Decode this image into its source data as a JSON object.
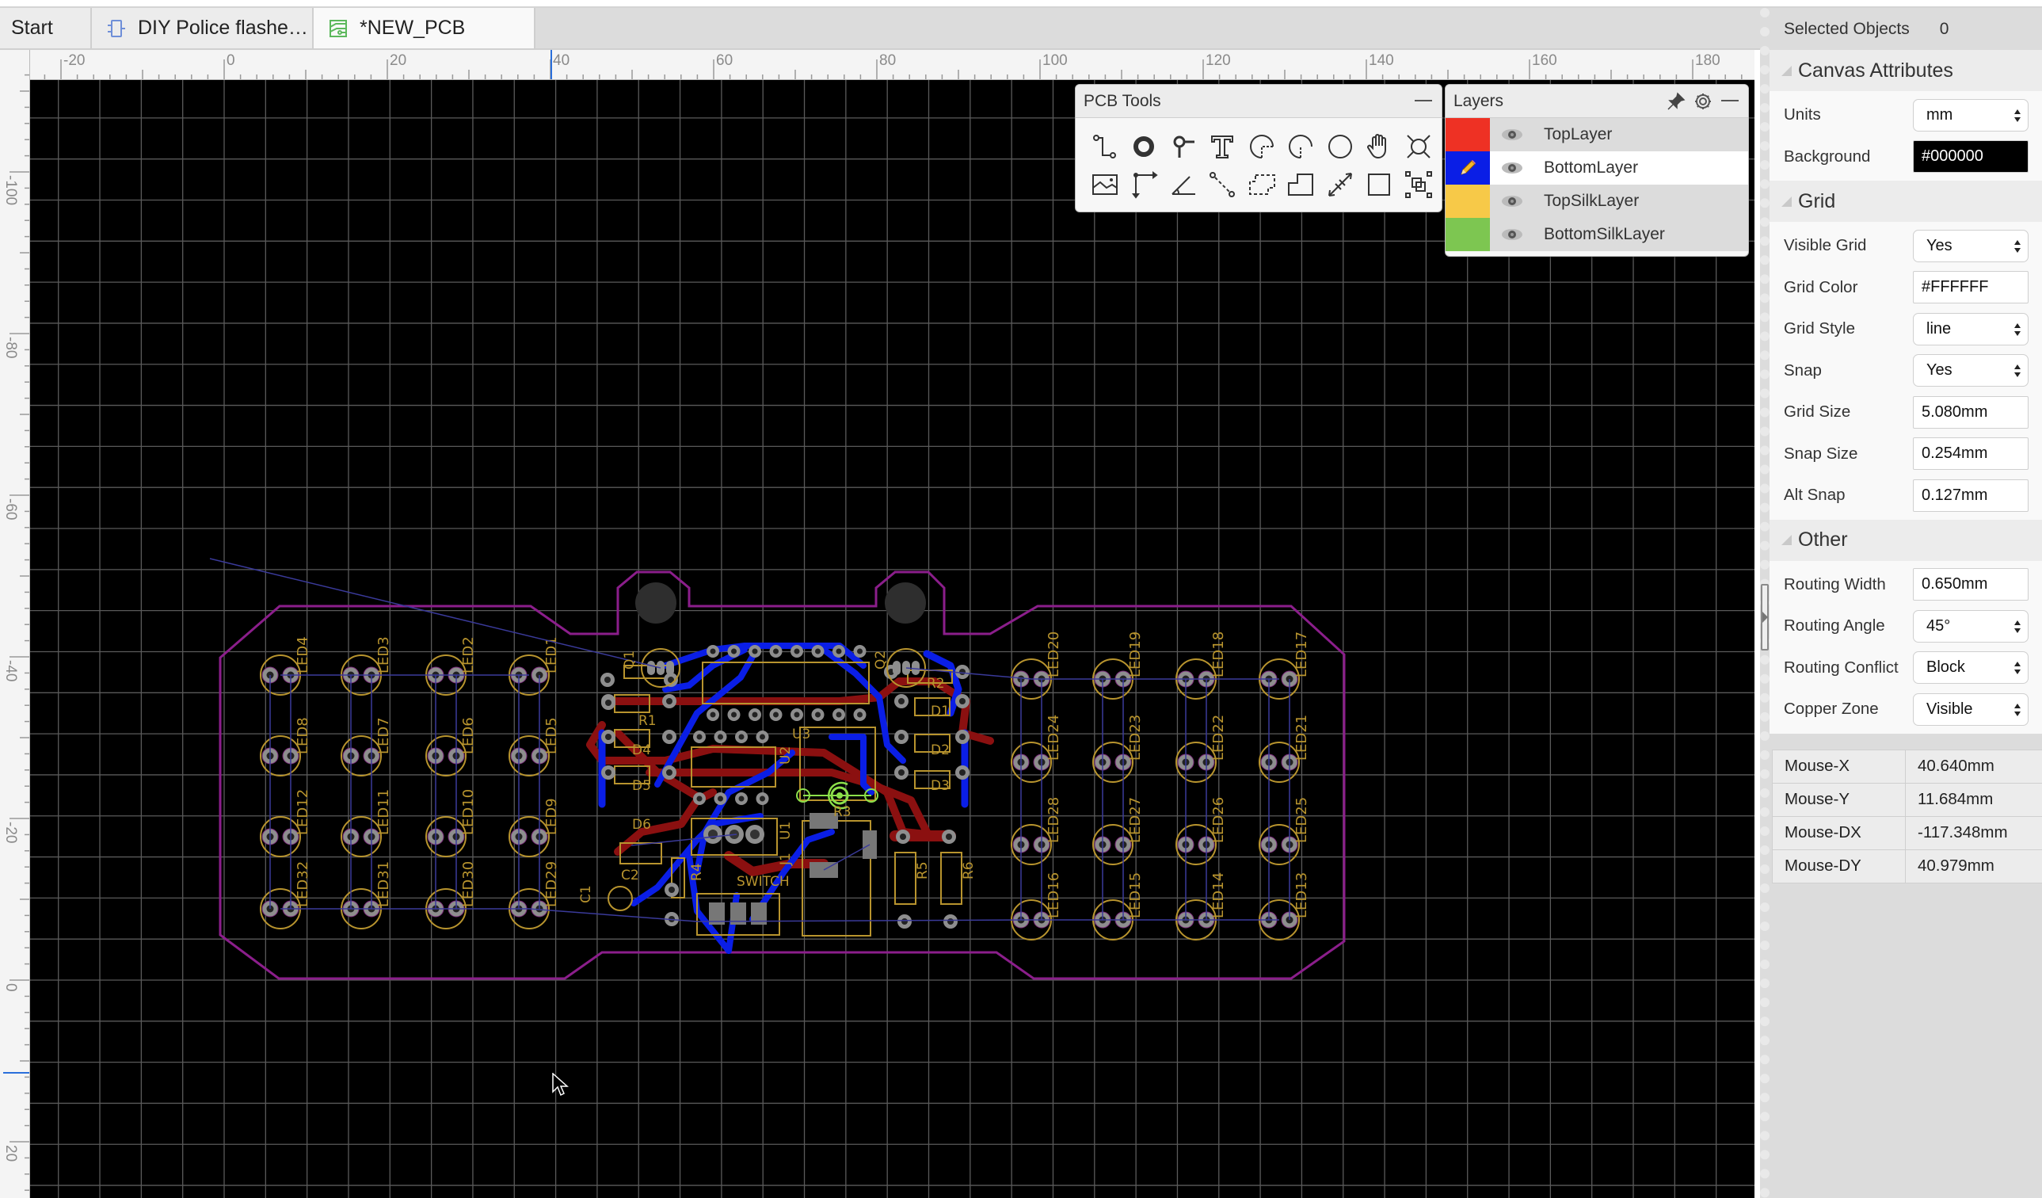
{
  "tabs": [
    {
      "label": "Start",
      "icon": "none",
      "active": false
    },
    {
      "label": "DIY Police flashe…",
      "icon": "schematic-icon",
      "active": false
    },
    {
      "label": "*NEW_PCB",
      "icon": "pcb-icon",
      "active": true
    }
  ],
  "rulers": {
    "horizontal_labels": [
      "-20",
      "0",
      "20",
      "40",
      "60",
      "80",
      "100",
      "120",
      "140",
      "160",
      "180"
    ],
    "vertical_labels": [
      "-100",
      "-80",
      "-60",
      "-40",
      "-20",
      "0",
      "20"
    ]
  },
  "pcb_tools": {
    "title": "PCB Tools",
    "tools": [
      {
        "name": "track",
        "icon": "track-icon"
      },
      {
        "name": "pad",
        "icon": "pad-icon"
      },
      {
        "name": "via",
        "icon": "via-icon"
      },
      {
        "name": "text",
        "icon": "text-icon"
      },
      {
        "name": "arc-center",
        "icon": "arc-center-icon"
      },
      {
        "name": "arc",
        "icon": "arc-icon"
      },
      {
        "name": "circle",
        "icon": "circle-icon"
      },
      {
        "name": "pan",
        "icon": "hand-icon"
      },
      {
        "name": "hole",
        "icon": "hole-icon"
      },
      {
        "name": "image",
        "icon": "image-icon"
      },
      {
        "name": "canvas-origin",
        "icon": "canvas-origin-icon"
      },
      {
        "name": "protractor",
        "icon": "protractor-icon"
      },
      {
        "name": "connect-pad",
        "icon": "connect-pad-icon"
      },
      {
        "name": "copper-area",
        "icon": "copper-area-icon"
      },
      {
        "name": "solid-region",
        "icon": "solid-region-icon"
      },
      {
        "name": "dimension",
        "icon": "dimension-icon"
      },
      {
        "name": "rectangle",
        "icon": "rectangle-icon"
      },
      {
        "name": "group",
        "icon": "group-icon"
      }
    ]
  },
  "layers": {
    "title": "Layers",
    "items": [
      {
        "name": "TopLayer",
        "color": "#EE3124",
        "active": false,
        "visible": true
      },
      {
        "name": "BottomLayer",
        "color": "#0A1EE6",
        "active": true,
        "visible": true
      },
      {
        "name": "TopSilkLayer",
        "color": "#F7C948",
        "active": false,
        "visible": true
      },
      {
        "name": "BottomSilkLayer",
        "color": "#7DC651",
        "active": false,
        "visible": true
      }
    ]
  },
  "properties": {
    "selected_label": "Selected Objects",
    "selected_count": "0",
    "canvas_section": "Canvas Attributes",
    "units_label": "Units",
    "units_value": "mm",
    "background_label": "Background",
    "background_value": "#000000",
    "grid_section": "Grid",
    "visible_grid_label": "Visible Grid",
    "visible_grid_value": "Yes",
    "grid_color_label": "Grid Color",
    "grid_color_value": "#FFFFFF",
    "grid_style_label": "Grid Style",
    "grid_style_value": "line",
    "snap_label": "Snap",
    "snap_value": "Yes",
    "grid_size_label": "Grid Size",
    "grid_size_value": "5.080mm",
    "snap_size_label": "Snap Size",
    "snap_size_value": "0.254mm",
    "alt_snap_label": "Alt Snap",
    "alt_snap_value": "0.127mm",
    "other_section": "Other",
    "routing_width_label": "Routing Width",
    "routing_width_value": "0.650mm",
    "routing_angle_label": "Routing Angle",
    "routing_angle_value": "45°",
    "routing_conflict_label": "Routing Conflict",
    "routing_conflict_value": "Block",
    "copper_zone_label": "Copper Zone",
    "copper_zone_value": "Visible"
  },
  "mouse": [
    {
      "label": "Mouse-X",
      "value": "40.640mm"
    },
    {
      "label": "Mouse-Y",
      "value": "11.684mm"
    },
    {
      "label": "Mouse-DX",
      "value": "-117.348mm"
    },
    {
      "label": "Mouse-DY",
      "value": "40.979mm"
    }
  ],
  "pcb": {
    "colors": {
      "outline": "#8B1E8B",
      "silk": "#B8942E",
      "top": "#8B1010",
      "bottom": "#0A1EE6",
      "ratline": "#3A3A9A",
      "pad": "#8E8E8E",
      "selected": "#8CE04A",
      "grid": "#5A5A5A"
    },
    "leds_left": [
      [
        "LED4",
        "LED3",
        "LED2",
        "LED1"
      ],
      [
        "LED8",
        "LED7",
        "LED6",
        "LED5"
      ],
      [
        "LED12",
        "LED11",
        "LED10",
        "LED9"
      ],
      [
        "LED32",
        "LED31",
        "LED30",
        "LED29"
      ]
    ],
    "leds_right": [
      [
        "LED20",
        "LED19",
        "LED18",
        "LED17"
      ],
      [
        "LED24",
        "LED23",
        "LED22",
        "LED21"
      ],
      [
        "LED28",
        "LED27",
        "LED26",
        "LED25"
      ],
      [
        "LED16",
        "LED15",
        "LED14",
        "LED13"
      ]
    ],
    "component_labels": {
      "Q1": "Q1",
      "Q2": "Q2",
      "R1": "R1",
      "R2": "R2",
      "R3": "R3",
      "R4": "R4",
      "R5": "R5",
      "R6": "R6",
      "D1": "D1",
      "D2": "D2",
      "D3": "D3",
      "D4": "D4",
      "D5": "D5",
      "D6": "D6",
      "U1": "U1",
      "U2": "U2",
      "U3": "U3",
      "J1": "J1",
      "C1": "C1",
      "C2": "C2",
      "SWITCH": "SWITCH"
    }
  }
}
